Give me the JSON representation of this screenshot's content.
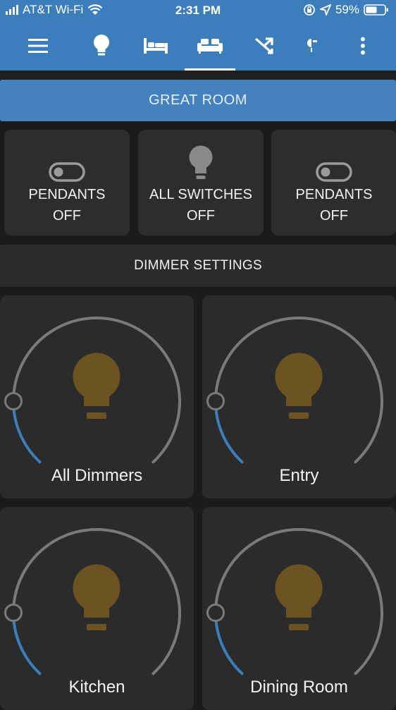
{
  "status_bar": {
    "carrier": "AT&T Wi-Fi",
    "time": "2:31 PM",
    "battery": "59%"
  },
  "toolbar": {
    "icons": [
      "menu-icon",
      "lightbulb-icon",
      "bed-icon",
      "sofa-icon",
      "shuffle-icon",
      "partial-icon",
      "more-vert-icon"
    ],
    "active_tab": "sofa-icon"
  },
  "room": {
    "title": "GREAT ROOM"
  },
  "switches": [
    {
      "name": "PENDANTS",
      "state": "OFF",
      "icon": "toggle-icon"
    },
    {
      "name": "ALL SWITCHES",
      "state": "OFF",
      "icon": "lightbulb-icon"
    },
    {
      "name": "PENDANTS",
      "state": "OFF",
      "icon": "toggle-icon"
    }
  ],
  "dimmer_section": {
    "title": "DIMMER SETTINGS"
  },
  "dimmers": [
    {
      "name": "All Dimmers",
      "level": 0
    },
    {
      "name": "Entry",
      "level": 0
    },
    {
      "name": "Kitchen",
      "level": 0
    },
    {
      "name": "Dining Room",
      "level": 0
    }
  ],
  "colors": {
    "primary": "#3c7dbb",
    "background": "#1b1b1b",
    "card": "#2b2b2b",
    "bulb_off": "#6b5322",
    "arc_track": "#7a7a7a",
    "arc_active": "#3c7dbb"
  }
}
